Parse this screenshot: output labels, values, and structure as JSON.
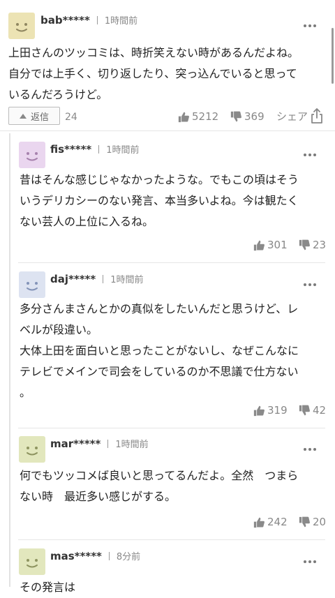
{
  "top_comment": {
    "user": "bab*****",
    "time": "1時間前",
    "lines": [
      "上田さんのツッコミは、時折笑えない時があるんだよね。",
      "自分では上手く、切り返したり、突っ込んでいると思って",
      "いるんだろうけど。"
    ],
    "reply_label": "返信",
    "reply_count": "24",
    "likes": "5212",
    "dislikes": "369",
    "share_label": "シェア",
    "avatar_color": "#ece3b4"
  },
  "replies": [
    {
      "user": "fis*****",
      "time": "1時間前",
      "lines": [
        "昔はそんな感じじゃなかったような。でもこの頃はそう",
        "いうデリカシーのない発言、本当多いよね。今は観たく",
        "ない芸人の上位に入るね。"
      ],
      "likes": "301",
      "dislikes": "23",
      "avatar_color": "#ead6ef"
    },
    {
      "user": "daj*****",
      "time": "1時間前",
      "lines": [
        "多分さんまさんとかの真似をしたいんだと思うけど、レ",
        "ベルが段違い。",
        "大体上田を面白いと思ったことがないし、なぜこんなに",
        "テレビでメインで司会をしているのか不思議で仕方ない",
        "。"
      ],
      "likes": "319",
      "dislikes": "42",
      "avatar_color": "#dde3f1"
    },
    {
      "user": "mar*****",
      "time": "1時間前",
      "lines": [
        "何でもツッコメば良いと思ってるんだよ。全然　つまら",
        "ない時　最近多い感じがする。"
      ],
      "likes": "242",
      "dislikes": "20",
      "avatar_color": "#e2e7bd"
    },
    {
      "user": "mas*****",
      "time": "8分前",
      "lines": [
        "その発言は"
      ],
      "avatar_color": "#e2e7bd"
    }
  ]
}
